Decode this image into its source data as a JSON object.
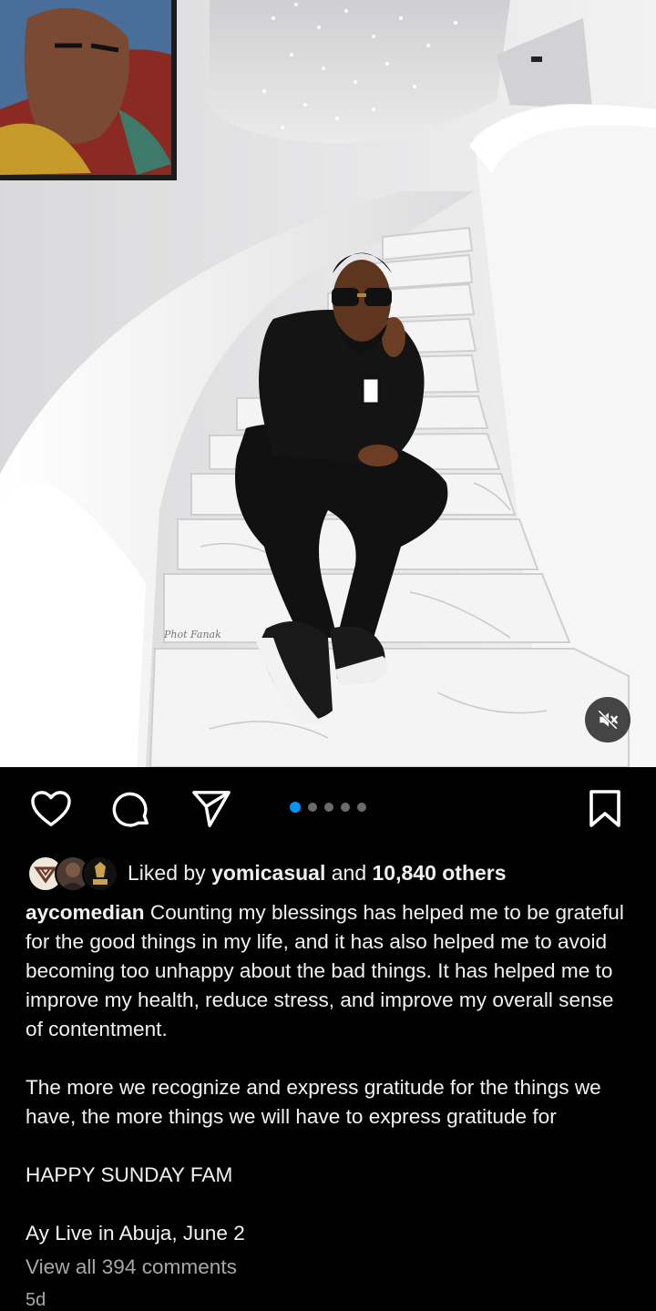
{
  "post": {
    "photo_credit": "Phot Fanak",
    "mute_icon": "speaker-muted-icon"
  },
  "actions": {
    "like_icon": "heart-outline-icon",
    "comment_icon": "comment-bubble-icon",
    "share_icon": "paper-plane-icon",
    "save_icon": "bookmark-outline-icon",
    "carousel_total": 5,
    "carousel_active_index": 0,
    "accent_color": "#0095f6"
  },
  "likes": {
    "prefix": "Liked by ",
    "user": "yomicasual",
    "middle": " and ",
    "others": "10,840 others"
  },
  "caption": {
    "username": "aycomedian",
    "text": " Counting my blessings has helped me to be grateful for the good things in my life, and it has also helped me to avoid becoming too unhappy about the bad things. It has helped me to improve my health, reduce stress, and improve my overall sense of contentment.",
    "paragraph2": "The more we recognize and express gratitude for the things we have, the more things we will have to express gratitude for",
    "paragraph3": "HAPPY SUNDAY FAM",
    "paragraph4": "Ay Live in Abuja, June 2"
  },
  "comments": {
    "view_all": "View all 394 comments"
  },
  "time_ago": "5d"
}
